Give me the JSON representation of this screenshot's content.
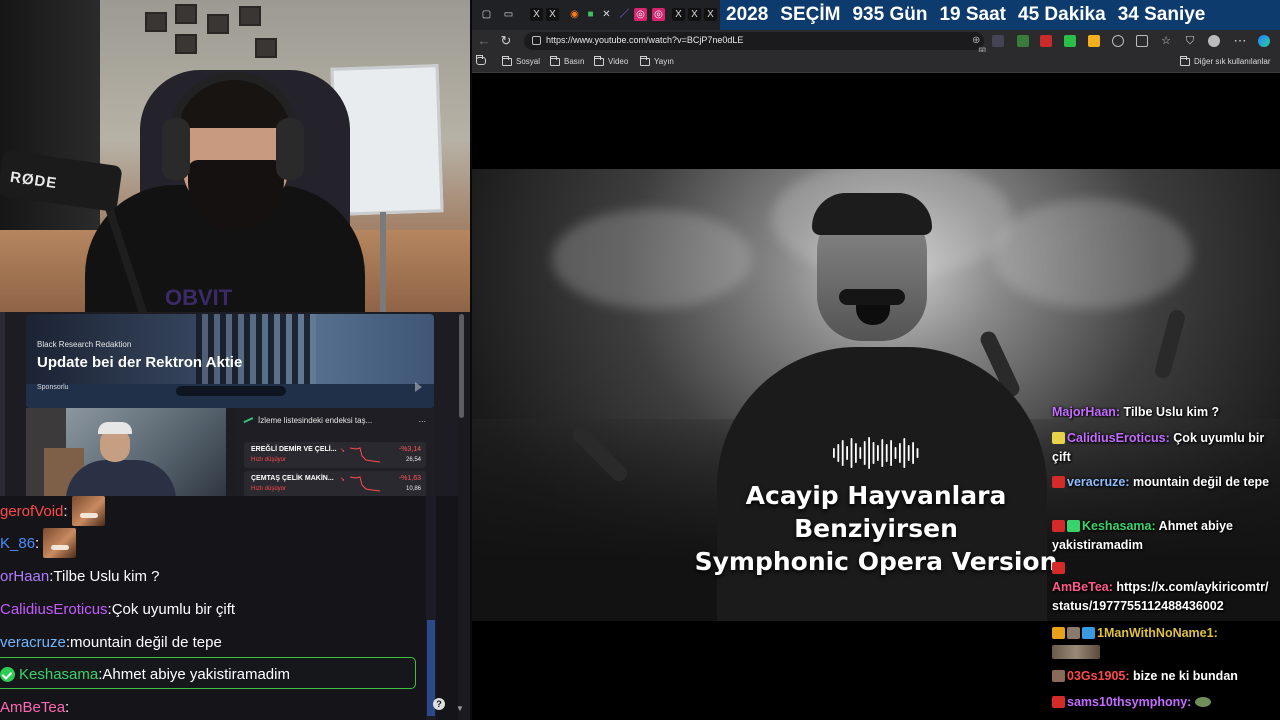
{
  "webcam": {
    "mic_brand": "RØDE",
    "shirt_text": "OBVIT"
  },
  "ad": {
    "source": "Black Research Redaktion",
    "title": "Update bei der Rektron Aktie",
    "sponsored": "Sponsorlu"
  },
  "watchlist": {
    "heading": "İzleme listesindeki endeksi taş...",
    "more": "...",
    "rows": [
      {
        "name": "EREĞLİ DEMİR VE ÇELİ...",
        "status": "Hızlı düşüyor",
        "change": "-%3,14",
        "price": "26,54"
      },
      {
        "name": "ÇEMTAŞ ÇELİK MAKİN...",
        "status": "Hızlı düşüyor",
        "change": "-%1,63",
        "price": "10,86"
      }
    ],
    "down_color": "#ff4b4b"
  },
  "chat_left": {
    "lines": [
      {
        "user": "gerofVoid",
        "color": "#ff4a4a",
        "sep": ":",
        "text": "",
        "emote": true
      },
      {
        "user": "K_86",
        "color": "#4a8cff",
        "sep": ":",
        "text": "",
        "emote": true
      },
      {
        "user": "orHaan",
        "color": "#b07cff",
        "sep": ":",
        "text": " Tilbe Uslu kim ?"
      },
      {
        "user": "CalidiusEroticus",
        "color": "#c45cff",
        "sep": ":",
        "text": " Çok uyumlu bir çift"
      },
      {
        "user": "veracruze",
        "color": "#6fb7ff",
        "sep": ":",
        "text": " mountain değil de tepe"
      },
      {
        "user": "Keshasama",
        "color": "#39d36b",
        "sep": ":",
        "text": " Ahmet abiye yakistiramadim"
      },
      {
        "user": "AmBeTea",
        "color": "#ff69b4",
        "sep": ":",
        "text": ""
      }
    ],
    "help": "?"
  },
  "browser": {
    "tabs": [
      "X",
      "X",
      "X",
      "X",
      "X"
    ],
    "countdown": {
      "year": "2028",
      "label": "SEÇİM",
      "days": "935 Gün",
      "hours": "19 Saat",
      "minutes": "45 Dakika",
      "seconds": "34 Saniye"
    },
    "url": "https://www.youtube.com/watch?v=BCjP7ne0dLE",
    "bookmarks": [
      "Sosyal",
      "Basın",
      "Video",
      "Yayın"
    ],
    "other_bookmarks": "Diğer sık kullanılanlar"
  },
  "video": {
    "title_lines": [
      "Acayip Hayvanlara",
      "Benziyirsen",
      "Symphonic Opera Version"
    ]
  },
  "chat_right": {
    "messages": [
      {
        "user": "MajorHaan",
        "color": "#c46cff",
        "text": "Tilbe Uslu kim ?",
        "badges": []
      },
      {
        "user": "CalidiusEroticus",
        "color": "#c46cff",
        "text": "Çok uyumlu bir çift",
        "badges": [
          "#e8d44a"
        ]
      },
      {
        "user": "veracruze",
        "color": "#8fbfff",
        "text": "mountain değil de tepe",
        "badges": [
          "#d42a2a"
        ]
      },
      {
        "user": "Keshasama",
        "color": "#39d36b",
        "text": "Ahmet abiye yakistiramadim",
        "badges": [
          "#d42a2a",
          "#39d36b"
        ]
      },
      {
        "user": "AmBeTea",
        "color": "#ff5a8a",
        "text": "https://x.com/aykiricomtr/status/1977755112488436002",
        "badges": [
          "#d42a2a"
        ]
      },
      {
        "user": "1ManWithNoName1",
        "color": "#e0c040",
        "text": "",
        "badges": [
          "#e8a21a",
          "#8a7a6a",
          "#3a9ae0"
        ],
        "emote": true
      },
      {
        "user": "03Gs1905",
        "color": "#ff4a4a",
        "text": "bize ne ki bundan",
        "badges": [
          "#8a6a5a"
        ]
      },
      {
        "user": "sams10thsymphony",
        "color": "#c46cff",
        "text": "",
        "badges": [
          "#d42a2a"
        ],
        "small_emote": true
      }
    ]
  }
}
